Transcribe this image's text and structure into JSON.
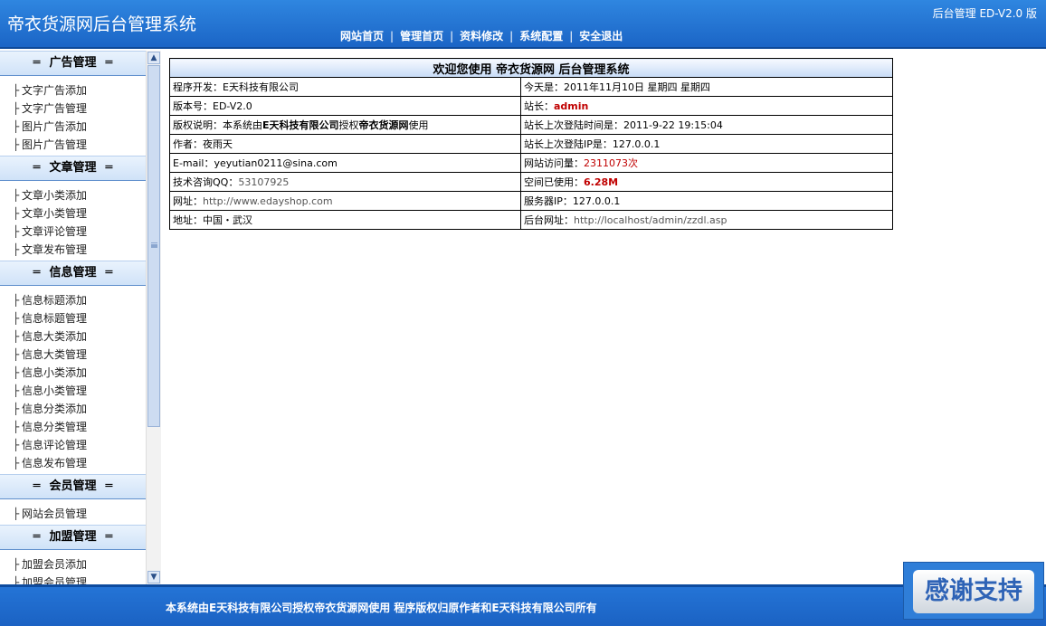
{
  "header": {
    "title": "帝衣货源网后台管理系统",
    "version": "后台管理 ED-V2.0 版",
    "nav": [
      "网站首页",
      "管理首页",
      "资料修改",
      "系统配置",
      "安全退出"
    ]
  },
  "sidebar": {
    "sections": [
      {
        "title": "广告管理",
        "items": [
          "文字广告添加",
          "文字广告管理",
          "图片广告添加",
          "图片广告管理"
        ]
      },
      {
        "title": "文章管理",
        "items": [
          "文章小类添加",
          "文章小类管理",
          "文章评论管理",
          "文章发布管理"
        ]
      },
      {
        "title": "信息管理",
        "items": [
          "信息标题添加",
          "信息标题管理",
          "信息大类添加",
          "信息大类管理",
          "信息小类添加",
          "信息小类管理",
          "信息分类添加",
          "信息分类管理",
          "信息评论管理",
          "信息发布管理"
        ]
      },
      {
        "title": "会员管理",
        "items": [
          "网站会员管理"
        ]
      },
      {
        "title": "加盟管理",
        "items": [
          "加盟会员添加",
          "加盟会员管理"
        ]
      }
    ]
  },
  "main": {
    "caption": "欢迎您使用 帝衣货源网 后台管理系统",
    "rows": [
      {
        "l_label": "程序开发：",
        "l_value": "E天科技有限公司",
        "r_label": "今天是：",
        "r_value": "2011年11月10日 星期四 星期四"
      },
      {
        "l_label": "版本号：",
        "l_value": "ED-V2.0",
        "r_label": "站长：",
        "r_value": "admin"
      },
      {
        "l_label": "版权说明：本系统由",
        "l_value": "E天科技有限公司",
        "l_mid": "授权",
        "l_value2": "帝衣货源网",
        "l_tail": "使用",
        "r_label": "站长上次登陆时间是：",
        "r_value": "2011-9-22 19:15:04"
      },
      {
        "l_label": "作者：",
        "l_value": "夜雨天",
        "r_label": "站长上次登陆IP是：",
        "r_value": "127.0.0.1"
      },
      {
        "l_label": "E-mail：",
        "l_value": "yeyutian0211@sina.com",
        "r_label": "网站访问量：",
        "r_value": "2311073次"
      },
      {
        "l_label": "技术咨询QQ：",
        "l_value": "53107925",
        "r_label": "空间已使用：",
        "r_value": "6.28M"
      },
      {
        "l_label": "网址：",
        "l_value": "http://www.edayshop.com",
        "r_label": "服务器IP：",
        "r_value": "127.0.0.1"
      },
      {
        "l_label": "地址：",
        "l_value": "中国・武汉",
        "r_label": "后台网址：",
        "r_value": "http://localhost/admin/zzdl.asp"
      }
    ]
  },
  "footer": {
    "text": "本系统由E天科技有限公司授权帝衣货源网使用 程序版权归原作者和E天科技有限公司所有"
  },
  "badge": {
    "text": "感谢支持"
  },
  "colors": {
    "header_blue": "#1b65c6",
    "section_header": "#cfe2f8",
    "highlight_red": "#c00000"
  }
}
